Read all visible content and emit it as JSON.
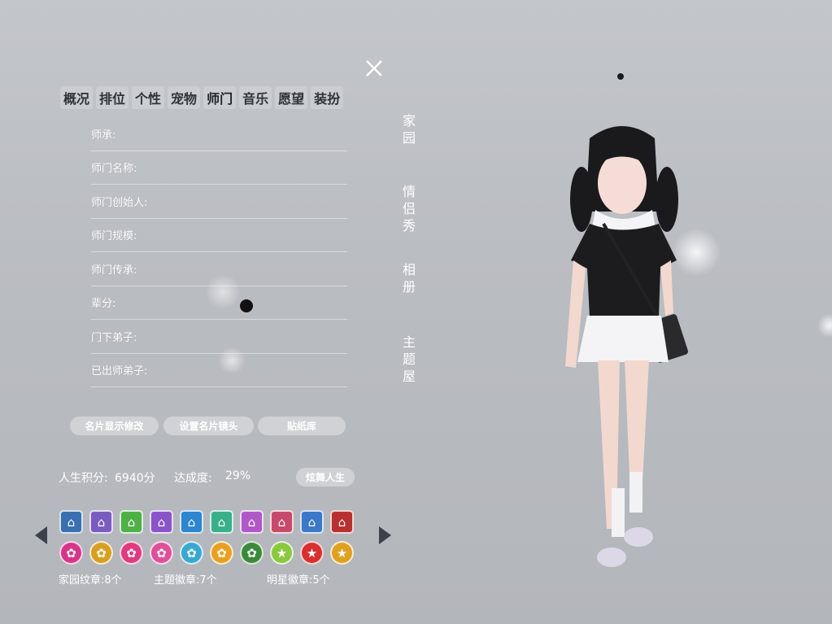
{
  "tabs": [
    "概况",
    "排位",
    "个性",
    "宠物",
    "师门",
    "音乐",
    "愿望",
    "装扮"
  ],
  "fields": [
    "师承:",
    "师门名称:",
    "师门创始人:",
    "师门规模:",
    "师门传承:",
    "辈分:",
    "门下弟子:",
    "已出师弟子:"
  ],
  "side_nav": [
    {
      "label": "家\n园"
    },
    {
      "label": "情\n侣\n秀"
    },
    {
      "label": "相\n册"
    },
    {
      "label": "主\n题\n屋"
    }
  ],
  "buttons": {
    "card_display_edit": "名片显示修改",
    "set_card_camera": "设置名片镜头",
    "sticker_library": "贴纸库",
    "dance_life": "炫舞人生"
  },
  "stats": {
    "life_score_label": "人生积分:",
    "life_score_value": "6940分",
    "completion_label": "达成度:",
    "completion_value": "29%"
  },
  "badges_row1": [
    {
      "icon": "home-crest-icon",
      "color": "#3a6fb0"
    },
    {
      "icon": "home-crest-icon",
      "color": "#7a5cc0"
    },
    {
      "icon": "home-crest-icon",
      "color": "#4fb046"
    },
    {
      "icon": "home-crest-icon",
      "color": "#8a55c8"
    },
    {
      "icon": "home-crest-icon",
      "color": "#2c86d0"
    },
    {
      "icon": "home-crest-icon",
      "color": "#38b08a"
    },
    {
      "icon": "home-crest-icon",
      "color": "#b058c8"
    },
    {
      "icon": "home-crest-icon",
      "color": "#c84a6a"
    },
    {
      "icon": "home-crest-icon",
      "color": "#3b78c8"
    },
    {
      "icon": "home-crest-icon",
      "color": "#b83030"
    }
  ],
  "badges_row2": [
    {
      "icon": "theme-badge-icon",
      "color": "#d8358a"
    },
    {
      "icon": "theme-badge-icon",
      "color": "#d8a020"
    },
    {
      "icon": "theme-badge-icon",
      "color": "#e03a80"
    },
    {
      "icon": "theme-badge-icon",
      "color": "#e0509a"
    },
    {
      "icon": "theme-badge-icon",
      "color": "#3aa8d0"
    },
    {
      "icon": "theme-badge-icon",
      "color": "#e8a020"
    },
    {
      "icon": "theme-badge-icon",
      "color": "#3a8a3a"
    },
    {
      "icon": "star-badge-icon",
      "color": "#8ac840"
    },
    {
      "icon": "star-badge-icon",
      "color": "#d83030"
    },
    {
      "icon": "star-badge-icon",
      "color": "#e0a020"
    }
  ],
  "medals": {
    "home": "家园纹章:8个",
    "theme": "主题徽章:7个",
    "star": "明星徽章:5个"
  }
}
